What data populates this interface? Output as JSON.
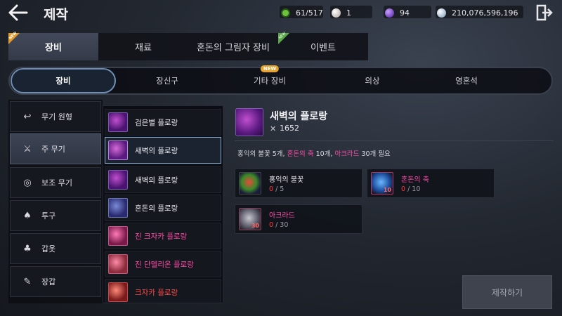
{
  "header": {
    "title": "제작",
    "back_icon": "arrow-left-icon",
    "exit_icon": "exit-door-icon",
    "currencies": [
      {
        "icon": "green-gem-icon",
        "value": "61/517",
        "color": "#6fc23d"
      },
      {
        "icon": "pearl-icon",
        "value": "1",
        "color": "#d8c8c8"
      },
      {
        "icon": "purple-orb-icon",
        "value": "94",
        "color": "#8a5cd8"
      },
      {
        "icon": "silver-coin-icon",
        "value": "210,076,596,196",
        "color": "#c8d8e8"
      }
    ]
  },
  "main_tabs": [
    {
      "label": "장비",
      "active": true,
      "badge": "NEW"
    },
    {
      "label": "재료",
      "active": false
    },
    {
      "label": "혼돈의 그림자 장비",
      "active": false
    },
    {
      "label": "이벤트",
      "active": false,
      "badge": "NEW"
    }
  ],
  "sub_tabs": [
    {
      "label": "장비",
      "active": true
    },
    {
      "label": "장신구"
    },
    {
      "label": "기타 장비",
      "badge": "NEW"
    },
    {
      "label": "의상"
    },
    {
      "label": "영혼석"
    }
  ],
  "categories": [
    {
      "label": "무기 원형",
      "icon": "return-arrow-icon"
    },
    {
      "label": "주 무기",
      "icon": "crossed-swords-icon",
      "active": true
    },
    {
      "label": "보조 무기",
      "icon": "orb-ring-icon"
    },
    {
      "label": "투구",
      "icon": "helmet-icon"
    },
    {
      "label": "갑옷",
      "icon": "armor-icon"
    },
    {
      "label": "장갑",
      "icon": "glove-icon"
    }
  ],
  "items": [
    {
      "name": "검은별 플로랑",
      "color": "#f0f0f4",
      "thumb": "purple"
    },
    {
      "name": "새벽의 플로랑",
      "color": "#f0f0f4",
      "thumb": "purple",
      "active": true
    },
    {
      "name": "새벽의 플로랑",
      "color": "#f0f0f4",
      "thumb": "purple"
    },
    {
      "name": "혼돈의 플로랑",
      "color": "#f0f0f4",
      "thumb": "blue"
    },
    {
      "name": "진 크자카 플로랑",
      "color": "#ff4aa8",
      "thumb": "pink"
    },
    {
      "name": "진 단델리온 플로랑",
      "color": "#ff4aa8",
      "thumb": "pink"
    },
    {
      "name": "크자카 플로랑",
      "color": "#ff4a4a",
      "thumb": "red"
    }
  ],
  "detail": {
    "name": "새벽의 플로랑",
    "power_icon": "crossed-swords-icon",
    "power": "1652",
    "requirement_parts": [
      {
        "text": "홍익의 불꽃 5개, ",
        "pink": false
      },
      {
        "text": "혼돈의 축",
        "pink": true
      },
      {
        "text": " 10개, ",
        "pink": false
      },
      {
        "text": "아크라드",
        "pink": true
      },
      {
        "text": " 30개 필요",
        "pink": false
      }
    ],
    "materials": [
      {
        "name": "홍익의 불꽃",
        "have": "0",
        "need": "/ 5",
        "qty_badge": "",
        "thumb": "fire"
      },
      {
        "name": "혼돈의 축",
        "have": "0",
        "need": "/ 10",
        "qty_badge": "10",
        "thumb": "crystal",
        "pink": true
      },
      {
        "name": "아크라드",
        "have": "0",
        "need": "/ 30",
        "qty_badge": "30",
        "thumb": "stone",
        "pink": true
      }
    ]
  },
  "craft_button": "제작하기"
}
